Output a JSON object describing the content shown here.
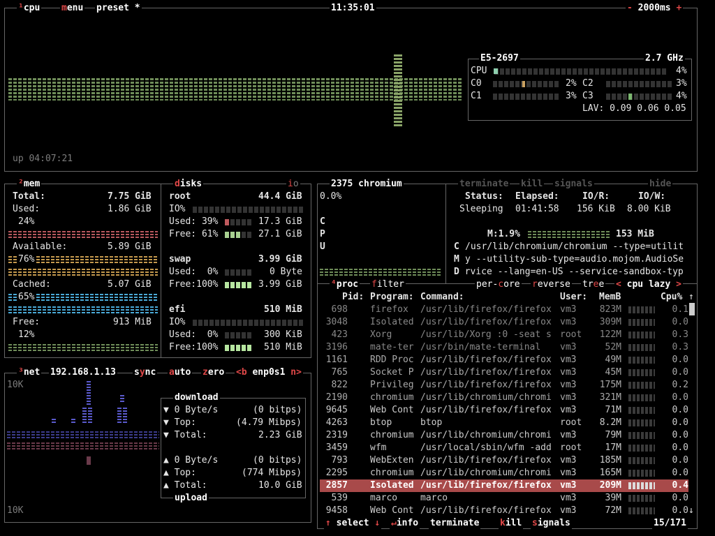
{
  "cpu_box": {
    "title_num": "¹",
    "title": "cpu",
    "menu": "menu",
    "preset": "preset *",
    "clock": "11:35:01",
    "interval_minus": "-",
    "interval": "2000ms",
    "interval_plus": "+",
    "uptime": "up 04:07:21",
    "model": "E5-2697",
    "freq": "2.7 GHz",
    "cpu_label": "CPU",
    "cpu_pct": "4%",
    "cores": [
      {
        "name": "C0",
        "pct": "2%"
      },
      {
        "name": "C1",
        "pct": "3%"
      },
      {
        "name": "C2",
        "pct": "3%"
      },
      {
        "name": "C3",
        "pct": "4%"
      }
    ],
    "lav_label": "LAV:",
    "lav": "0.09 0.06 0.05"
  },
  "mem_box": {
    "title_num": "²",
    "title": "mem",
    "total_label": "Total:",
    "total": "7.75 GiB",
    "used_label": "Used:",
    "used": "1.86 GiB",
    "used_pct": "24%",
    "avail_label": "Available:",
    "avail": "5.89 GiB",
    "avail_pct": "76%",
    "cached_label": "Cached:",
    "cached": "5.07 GiB",
    "cached_pct": "65%",
    "free_label": "Free:",
    "free": "913 MiB",
    "free_pct": "12%"
  },
  "disks_box": {
    "title": "disks",
    "io": "io",
    "root": {
      "name": "root",
      "size": "44.4 GiB",
      "io": "IO%",
      "used_label": "Used: 39%",
      "used": "17.3 GiB",
      "free_label": "Free: 61%",
      "free": "27.1 GiB"
    },
    "swap": {
      "name": "swap",
      "size": "3.99 GiB",
      "used_label": "Used:  0%",
      "used": "0 Byte",
      "free_label": "Free:100%",
      "free": "3.99 GiB"
    },
    "efi": {
      "name": "efi",
      "size": "510 MiB",
      "io": "IO%",
      "used_label": "Used:  0%",
      "used": "300 KiB",
      "free_label": "Free:100%",
      "free": "510 MiB"
    }
  },
  "net_box": {
    "title_num": "³",
    "title": "net",
    "ip": "192.168.1.13",
    "sync": "sync",
    "auto": "auto",
    "zero": "zero",
    "prev": "<b",
    "iface": "enp0s1",
    "next": "n>",
    "scale_top": "10K",
    "scale_bottom": "10K",
    "download_title": "download",
    "upload_title": "upload",
    "dl_rate": "0 Byte/s",
    "dl_bits": "(0 bitps)",
    "dl_top_label": "Top:",
    "dl_top": "(4.79 Mibps)",
    "dl_total_label": "Total:",
    "dl_total": "2.23 GiB",
    "ul_rate": "0 Byte/s",
    "ul_bits": "(0 bitps)",
    "ul_top_label": "Top:",
    "ul_top": "(774 Mibps)",
    "ul_total_label": "Total:",
    "ul_total": "10.0 GiB"
  },
  "detail_box": {
    "pid": "2375",
    "name": "chromium",
    "cpu_pct": "0.0%",
    "cpu_letters": [
      "C",
      "P",
      "U"
    ],
    "terminate": "terminate",
    "kill": "kill",
    "signals": "signals",
    "hide": "hide",
    "status_label": "Status:",
    "status": "Sleeping",
    "elapsed_label": "Elapsed:",
    "elapsed": "01:41:58",
    "ior_label": "IO/R:",
    "ior": "156 KiB",
    "iow_label": "IO/W:",
    "iow": "8.00 KiB",
    "mem_label": "M:1.9%",
    "mem": "153 MiB",
    "cmd_letters": [
      "C",
      "M",
      "D"
    ],
    "cmd_lines": [
      "/usr/lib/chromium/chromium --type=utilit",
      "y --utility-sub-type=audio.mojom.AudioSe",
      "rvice --lang=en-US --service-sandbox-typ"
    ]
  },
  "proc_box": {
    "title_num": "⁴",
    "title": "proc",
    "filter": "filter",
    "per_core": "per-core",
    "reverse": "reverse",
    "tree": "tree",
    "sort_prev": "<",
    "sort": "cpu lazy",
    "sort_next": ">",
    "headers": {
      "pid": "Pid:",
      "program": "Program:",
      "command": "Command:",
      "user": "User:",
      "mem": "MemB",
      "cpu": "Cpu%"
    },
    "rows": [
      {
        "pid": "698",
        "program": "firefox",
        "command": "/usr/lib/firefox/firefox",
        "user": "vm3",
        "mem": "823M",
        "cpu": "0.1"
      },
      {
        "pid": "3048",
        "program": "Isolated",
        "command": "/usr/lib/firefox/firefox",
        "user": "vm3",
        "mem": "309M",
        "cpu": "0.0"
      },
      {
        "pid": "423",
        "program": "Xorg",
        "command": "/usr/lib/Xorg :0 -seat s",
        "user": "root",
        "mem": "122M",
        "cpu": "0.3"
      },
      {
        "pid": "3196",
        "program": "mate-ter",
        "command": "/usr/bin/mate-terminal",
        "user": "vm3",
        "mem": "52M",
        "cpu": "0.3"
      },
      {
        "pid": "1161",
        "program": "RDD Proc",
        "command": "/usr/lib/firefox/firefox",
        "user": "vm3",
        "mem": "49M",
        "cpu": "0.0"
      },
      {
        "pid": "765",
        "program": "Socket P",
        "command": "/usr/lib/firefox/firefox",
        "user": "vm3",
        "mem": "45M",
        "cpu": "0.0"
      },
      {
        "pid": "822",
        "program": "Privileg",
        "command": "/usr/lib/firefox/firefox",
        "user": "vm3",
        "mem": "175M",
        "cpu": "0.2"
      },
      {
        "pid": "2190",
        "program": "chromium",
        "command": "/usr/lib/chromium/chromi",
        "user": "vm3",
        "mem": "321M",
        "cpu": "0.0"
      },
      {
        "pid": "9645",
        "program": "Web Cont",
        "command": "/usr/lib/firefox/firefox",
        "user": "vm3",
        "mem": "71M",
        "cpu": "0.0"
      },
      {
        "pid": "4263",
        "program": "btop",
        "command": "btop",
        "user": "root",
        "mem": "8.2M",
        "cpu": "0.0"
      },
      {
        "pid": "2319",
        "program": "chromium",
        "command": "/usr/lib/chromium/chromi",
        "user": "vm3",
        "mem": "79M",
        "cpu": "0.0"
      },
      {
        "pid": "3459",
        "program": "wfm",
        "command": "/usr/local/sbin/wfm -add",
        "user": "root",
        "mem": "17M",
        "cpu": "0.0"
      },
      {
        "pid": "793",
        "program": "WebExten",
        "command": "/usr/lib/firefox/firefox",
        "user": "vm3",
        "mem": "185M",
        "cpu": "0.0"
      },
      {
        "pid": "2295",
        "program": "chromium",
        "command": "/usr/lib/chromium/chromi",
        "user": "vm3",
        "mem": "165M",
        "cpu": "0.0"
      },
      {
        "pid": "2857",
        "program": "Isolated",
        "command": "/usr/lib/firefox/firefox",
        "user": "vm3",
        "mem": "209M",
        "cpu": "0.4"
      },
      {
        "pid": "539",
        "program": "marco",
        "command": "marco",
        "user": "vm3",
        "mem": "39M",
        "cpu": "0.0"
      },
      {
        "pid": "9458",
        "program": "Web Cont",
        "command": "/usr/lib/firefox/firefox",
        "user": "vm3",
        "mem": "72M",
        "cpu": "0.0"
      }
    ],
    "selected_index": 14,
    "footer": {
      "select": "select",
      "info": "info",
      "terminate": "terminate",
      "kill": "kill",
      "signals": "signals",
      "count": "15/171"
    }
  },
  "colors": {
    "highlight": "#e04848",
    "cpu_graph": "#6f8d59",
    "selected_row": "#a84a4a",
    "net_graph": "#5a5acc"
  }
}
